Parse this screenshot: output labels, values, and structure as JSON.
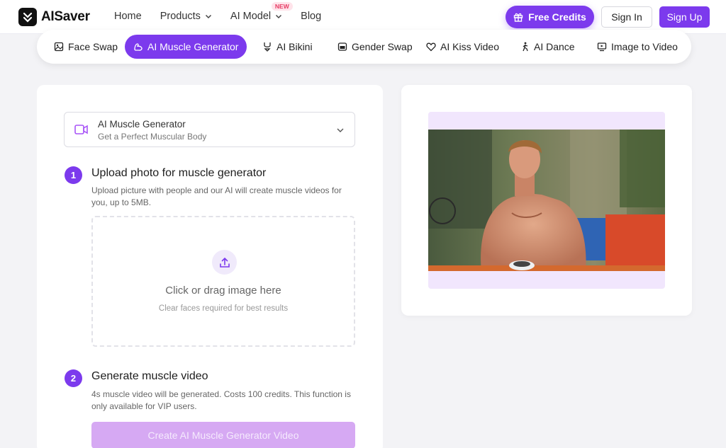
{
  "brand": {
    "name": "AISaver"
  },
  "nav": {
    "items": [
      {
        "label": "Home"
      },
      {
        "label": "Products"
      },
      {
        "label": "AI Model",
        "badge": "NEW"
      },
      {
        "label": "Blog"
      }
    ],
    "free_credits": "Free Credits",
    "sign_in": "Sign In",
    "sign_up": "Sign Up"
  },
  "tabs": [
    {
      "label": "Face Swap",
      "icon": "image-icon"
    },
    {
      "label": "AI Muscle Generator",
      "icon": "muscle-icon",
      "active": true
    },
    {
      "label": "AI Bikini",
      "icon": "bikini-icon"
    },
    {
      "label": "Gender Swap",
      "icon": "gender-swap-icon"
    },
    {
      "label": "AI Kiss Video",
      "icon": "heart-icon"
    },
    {
      "label": "AI Dance",
      "icon": "dance-icon"
    },
    {
      "label": "Image to Video",
      "icon": "monitor-icon"
    }
  ],
  "selector": {
    "title": "AI Muscle Generator",
    "subtitle": "Get a Perfect Muscular Body"
  },
  "steps": [
    {
      "number": "1",
      "title": "Upload photo for muscle generator",
      "description": "Upload picture with people and our AI will create muscle videos for you, up to 5MB."
    },
    {
      "number": "2",
      "title": "Generate muscle video",
      "description": "4s muscle video will be generated. Costs 100 credits. This function is only available for VIP users."
    }
  ],
  "dropzone": {
    "title": "Click or drag image here",
    "hint": "Clear faces required for best results"
  },
  "create_button": "Create AI Muscle Generator Video",
  "colors": {
    "accent": "#7c3aed",
    "accent_disabled": "#d6a9f3",
    "preview_bg": "#f1e6fd"
  }
}
